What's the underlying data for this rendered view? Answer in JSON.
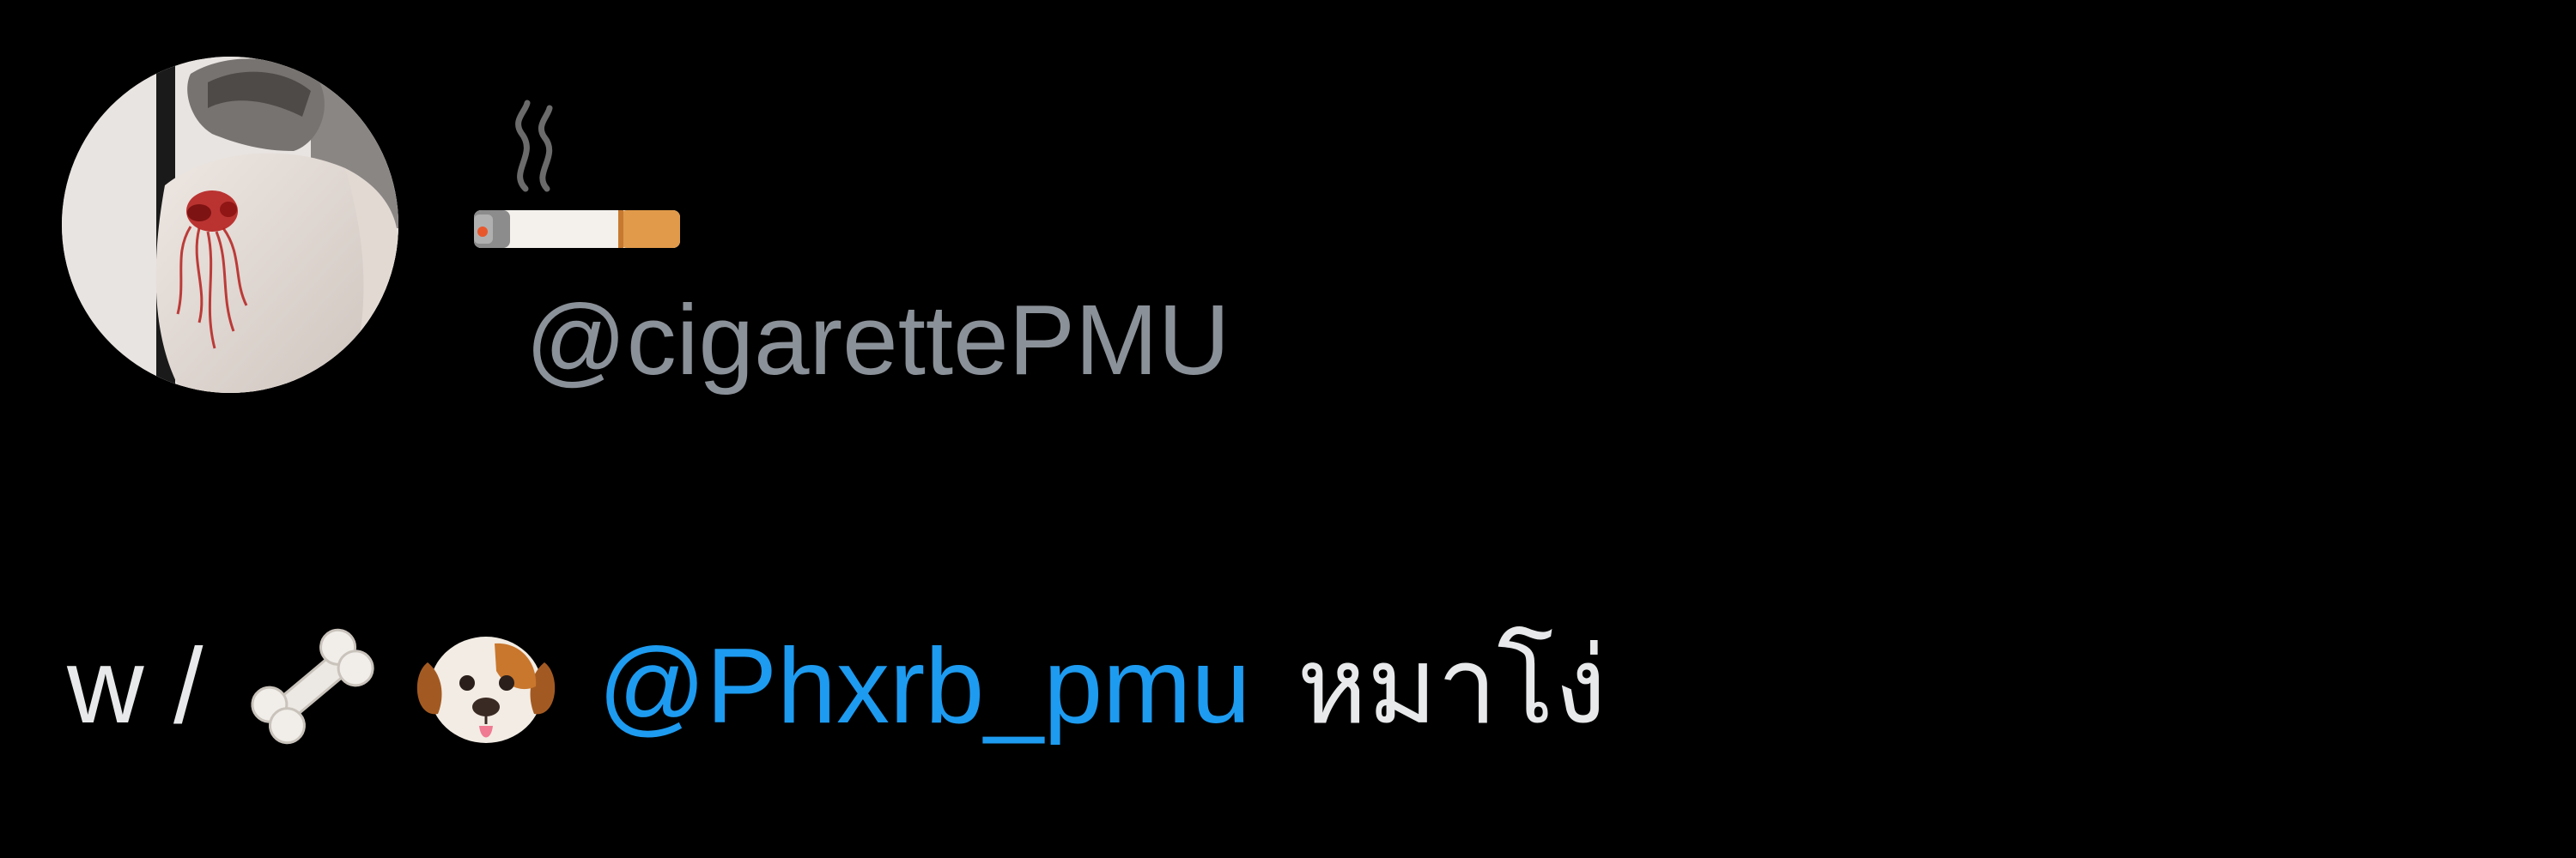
{
  "tweet": {
    "author": {
      "display_name_icons": [
        "smoke-icon",
        "cigarette-icon"
      ],
      "handle": "@cigarettePMU",
      "avatar": "avatar"
    },
    "body": {
      "prefix": "w /",
      "emojis": [
        "bone-icon",
        "dog-face-icon"
      ],
      "mention": "@Phxrb_pmu",
      "text": "หมาโง่"
    }
  },
  "colors": {
    "background": "#000000",
    "text_primary": "#e7e9ea",
    "text_secondary": "#8b9198",
    "mention": "#1d9bf0"
  }
}
